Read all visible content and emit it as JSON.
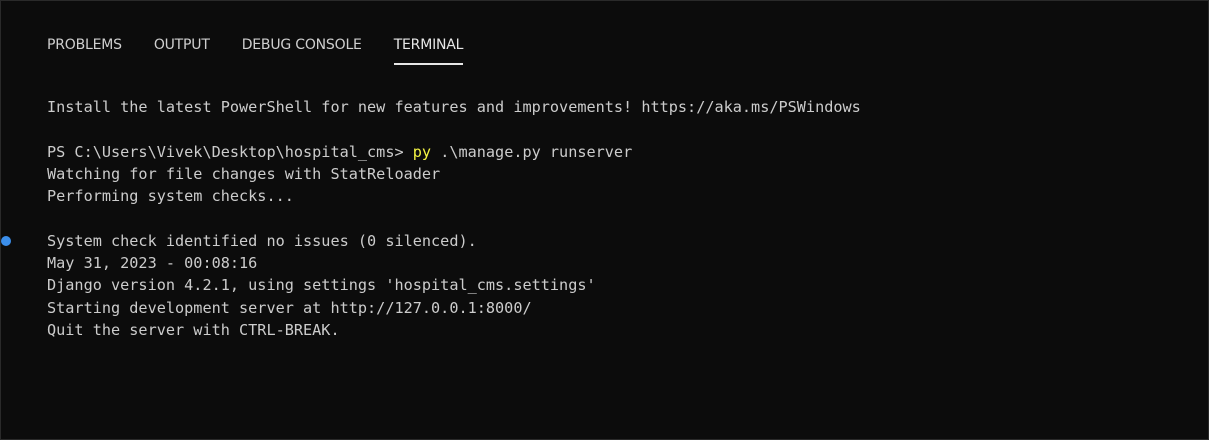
{
  "panel": {
    "tabs": [
      {
        "label": "PROBLEMS",
        "active": false
      },
      {
        "label": "OUTPUT",
        "active": false
      },
      {
        "label": "DEBUG CONSOLE",
        "active": false
      },
      {
        "label": "TERMINAL",
        "active": true
      }
    ]
  },
  "terminal": {
    "banner": "Install the latest PowerShell for new features and improvements! https://aka.ms/PSWindows",
    "prompt": "PS C:\\Users\\Vivek\\Desktop\\hospital_cms> ",
    "command_exe": "py",
    "command_args": " .\\manage.py runserver",
    "output_1": "Watching for file changes with StatReloader",
    "output_2": "Performing system checks...",
    "output_3": "System check identified no issues (0 silenced).",
    "output_4": "May 31, 2023 - 00:08:16",
    "output_5": "Django version 4.2.1, using settings 'hospital_cms.settings'",
    "output_6": "Starting development server at http://127.0.0.1:8000/",
    "output_7": "Quit the server with CTRL-BREAK."
  },
  "colors": {
    "background": "#0c0c0c",
    "text": "#cccccc",
    "command_highlight": "#f5f543",
    "decoration_dot": "#3b8eea"
  }
}
